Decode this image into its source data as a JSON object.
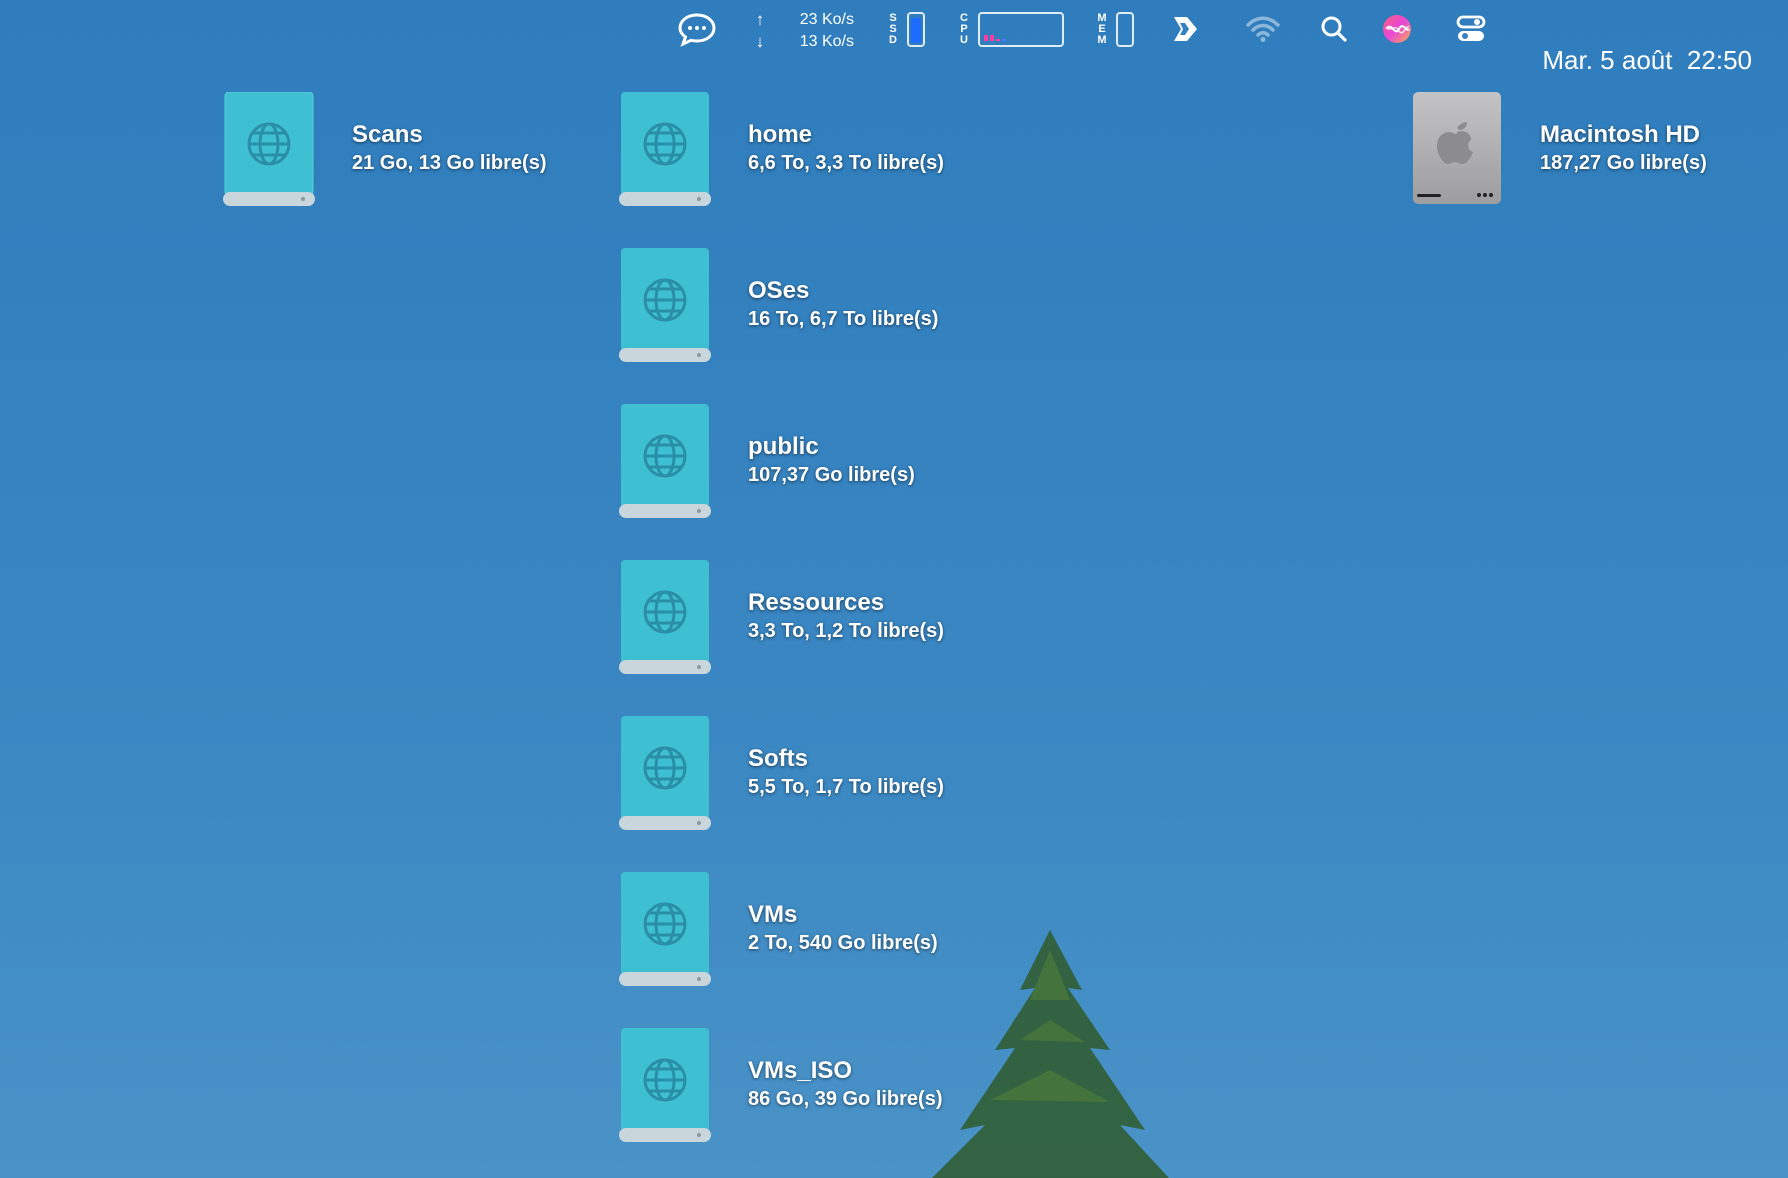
{
  "menubar": {
    "network": {
      "up_arrow": "↑",
      "down_arrow": "↓",
      "upload": "23 Ko/s",
      "download": "13 Ko/s"
    },
    "ssd_label": [
      "S",
      "S",
      "D"
    ],
    "cpu_label": [
      "C",
      "P",
      "U"
    ],
    "mem_label": [
      "M",
      "E",
      "M"
    ],
    "date": "Mar. 5 août",
    "time": "22:50",
    "icons": [
      "chat-bubble-icon",
      "network-arrows",
      "ssd-gauge",
      "cpu-graph",
      "memory-gauge",
      "forward-app-icon",
      "wifi-icon",
      "search-icon",
      "siri-icon",
      "control-center-icon"
    ],
    "colors": {
      "ssd_fill": "#1e6bff",
      "cpu_bars": "#ff3fa4"
    }
  },
  "volumes": [
    {
      "name": "Scans",
      "info": "21 Go, 13 Go libre(s)",
      "type": "network"
    },
    {
      "name": "home",
      "info": "6,6 To, 3,3 To libre(s)",
      "type": "network"
    },
    {
      "name": "Macintosh HD",
      "info": "187,27 Go libre(s)",
      "type": "internal"
    },
    {
      "name": "OSes",
      "info": "16 To, 6,7 To libre(s)",
      "type": "network"
    },
    {
      "name": "public",
      "info": "107,37 Go libre(s)",
      "type": "network"
    },
    {
      "name": "Ressources",
      "info": "3,3 To, 1,2 To libre(s)",
      "type": "network"
    },
    {
      "name": "Softs",
      "info": "5,5 To, 1,7 To libre(s)",
      "type": "network"
    },
    {
      "name": "VMs",
      "info": "2 To, 540 Go libre(s)",
      "type": "network"
    },
    {
      "name": "VMs_ISO",
      "info": "86 Go, 39 Go libre(s)",
      "type": "network"
    }
  ],
  "colors": {
    "desktop": "#3582c0",
    "network_drive": "#3fc0d2",
    "internal_drive": "#a9a9ab"
  }
}
